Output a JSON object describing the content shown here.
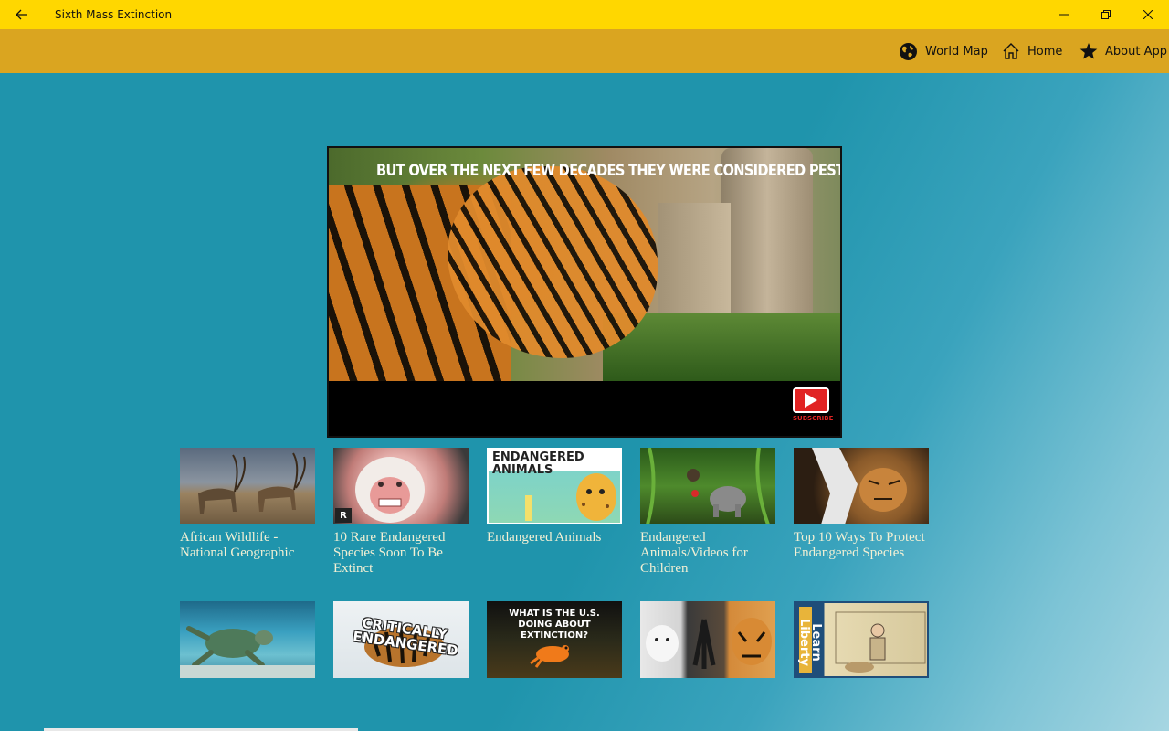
{
  "window": {
    "title": "Sixth Mass Extinction",
    "back_icon": "back-arrow-icon",
    "controls": [
      "minimize-icon",
      "restore-icon",
      "close-icon"
    ]
  },
  "commandbar": {
    "items": [
      {
        "label": "World Map",
        "icon": "globe-icon"
      },
      {
        "label": "Home",
        "icon": "home-icon"
      },
      {
        "label": "About App",
        "icon": "star-icon"
      }
    ]
  },
  "player": {
    "caption": "BUT OVER THE NEXT FEW DECADES THEY WERE CONSIDERED PESTS.",
    "subscribe_label": "SUBSCRIBE"
  },
  "videos": [
    {
      "title": "African Wildlife - National Geographic"
    },
    {
      "title": "10 Rare Endangered Species Soon To Be Extinct"
    },
    {
      "title": "Endangered Animals",
      "thumb_text": "ENDANGERED ANIMALS"
    },
    {
      "title": "Endangered Animals/Videos for Children"
    },
    {
      "title": "Top 10 Ways To Protect Endangered Species"
    },
    {
      "title": ""
    },
    {
      "title": "",
      "thumb_text": "CRITICALLY ENDANGERED"
    },
    {
      "title": "",
      "thumb_text": "WHAT IS THE U.S. DOING ABOUT EXTINCTION?"
    },
    {
      "title": ""
    },
    {
      "title": "",
      "thumb_text": "Learn Liberty"
    }
  ],
  "colors": {
    "titlebar": "#ffd700",
    "commandbar": "#daa520",
    "background": "#1f95ad",
    "video_title": "#f3f0d4"
  }
}
